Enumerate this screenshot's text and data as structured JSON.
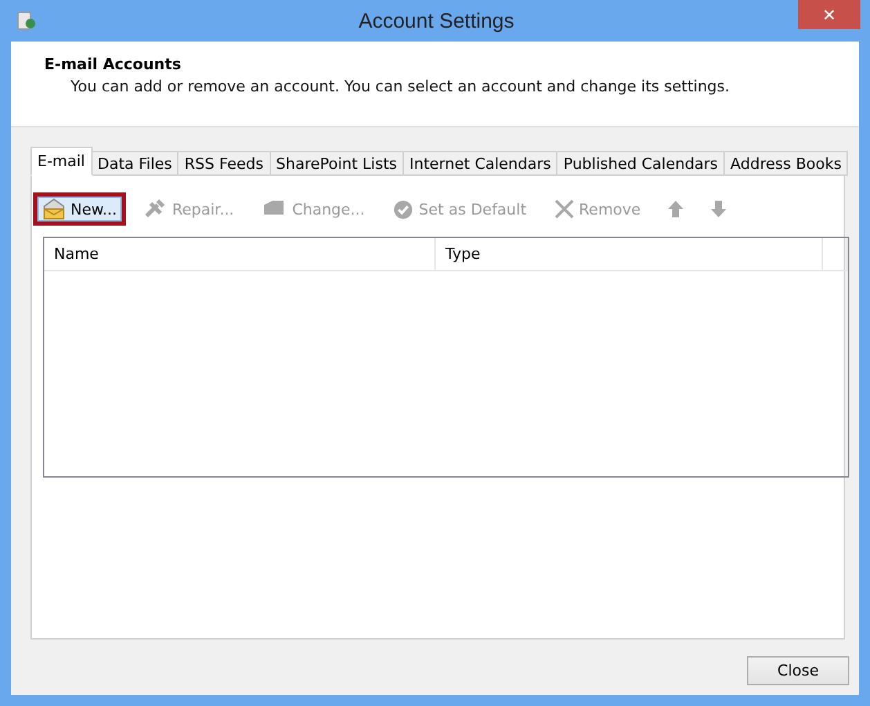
{
  "window": {
    "title": "Account Settings",
    "close": "✕"
  },
  "header": {
    "title": "E-mail Accounts",
    "description": "You can add or remove an account. You can select an account and change its settings."
  },
  "tabs": [
    {
      "label": "E-mail",
      "selected": true
    },
    {
      "label": "Data Files",
      "selected": false
    },
    {
      "label": "RSS Feeds",
      "selected": false
    },
    {
      "label": "SharePoint Lists",
      "selected": false
    },
    {
      "label": "Internet Calendars",
      "selected": false
    },
    {
      "label": "Published Calendars",
      "selected": false
    },
    {
      "label": "Address Books",
      "selected": false
    }
  ],
  "toolbar": [
    {
      "kind": "new",
      "label": "New...",
      "disabled": false,
      "highlighted": true
    },
    {
      "kind": "repair",
      "label": "Repair...",
      "disabled": true,
      "highlighted": false
    },
    {
      "kind": "change",
      "label": "Change...",
      "disabled": true,
      "highlighted": false
    },
    {
      "kind": "default",
      "label": "Set as Default",
      "disabled": true,
      "highlighted": false
    },
    {
      "kind": "remove",
      "label": "Remove",
      "disabled": true,
      "highlighted": false
    },
    {
      "kind": "up",
      "disabled": true,
      "highlighted": false
    },
    {
      "kind": "down",
      "disabled": true,
      "highlighted": false
    }
  ],
  "table": {
    "columns": [
      "Name",
      "Type"
    ]
  },
  "buttons": [
    "Close"
  ]
}
